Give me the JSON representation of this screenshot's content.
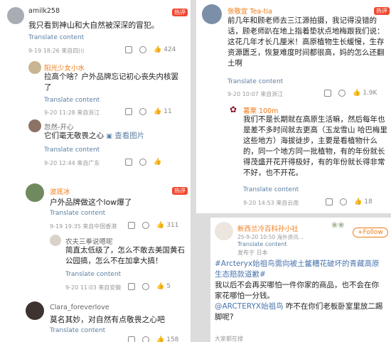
{
  "left": {
    "c1": {
      "user": "amilk258",
      "hot": "热评",
      "text": "我只看到神山和大自然被深深的冒犯。",
      "translate": "Translate content",
      "meta": "9-19 18:26 来自四川",
      "likes": "424"
    },
    "r1": {
      "user": "阳光少女小水",
      "text": "拉高个啥？户外品牌忘记初心丧失内核罢了",
      "translate": "Translate content",
      "meta": "9-20 11:28 来自浙江",
      "likes": "11"
    },
    "r2": {
      "user": "忽然-开心",
      "text": "它们毫无敬畏之心",
      "link_text": "查看图片",
      "translate": "Translate content",
      "meta": "9-20 12:44 来自广东"
    },
    "c2": {
      "user": "波底冰",
      "hot": "热评",
      "text": "户外品牌做这个low爆了",
      "translate": "Translate content",
      "meta": "9-19 19:35 来自中国香港",
      "likes": "311"
    },
    "r3": {
      "user": "农夫三拳说嗯呢",
      "text": "简直太低级了，怎么不敢去美国黄石公园搞，怎么不在加拿大搞！",
      "translate": "Translate content",
      "meta": "9-20 11:03 来自安徽",
      "likes": "5"
    },
    "c3": {
      "user": "Clara_foreverlove",
      "text": "莫名其妙，对自然有点敬畏之心吧",
      "translate": "Translate content",
      "likes": "158"
    }
  },
  "right": {
    "c1": {
      "user": "张敬宜 Tea-tia",
      "hot": "热评",
      "text": "前几年和顾老师去三江源拍摄，我记得没错的话，顾老师趴在地上指着垫状点地梅跟我们说：这花几年才长几厘米！高原植物生长缓慢，生存资源匮乏，恢复难度时间都很高，妈的怎么还翻土啊",
      "translate": "Translate content",
      "meta": "9-20 10:07 来自浙江",
      "likes": "1.9K"
    },
    "r1": {
      "user": "薯栗 100m",
      "text": "我们不是长期就在高原生活嘛，然后每年也是差不多时间就去更高（玉龙雪山 哈巴梅里这些地方）海拔徒步，主要是看植物什么的，同一个地方同一批植物，有的年份就长得茂盛开花开得极好，有的年份就长得非常不好，也不开花。",
      "translate": "Translate content",
      "meta": "9-20 14:53 来自云南",
      "likes": "18"
    },
    "post": {
      "user": "新西兰冷百科孙小社",
      "meta": "25-9-20 10:50 海外资讯...",
      "translate": "Translate content",
      "lang_note": "发布于 日本",
      "follow": "+Follow",
      "hashtag": "#Arcteryx始祖鸟需向被土鳖糟花破坏的青藏高原生态赔款道歉#",
      "line1": "我以后不会再买哪怕一件你家的商品，也不会在你家花哪怕一分钱。",
      "mention": "@ARCTERYX始祖鸟",
      "line2": " 咋不在你们老板卧室里放二踢脚呢?",
      "footer": "大家都在搜"
    }
  },
  "colors": {
    "accent": "#f07a14",
    "link": "#5b7fa3",
    "hot_bg": "#f0462f"
  }
}
